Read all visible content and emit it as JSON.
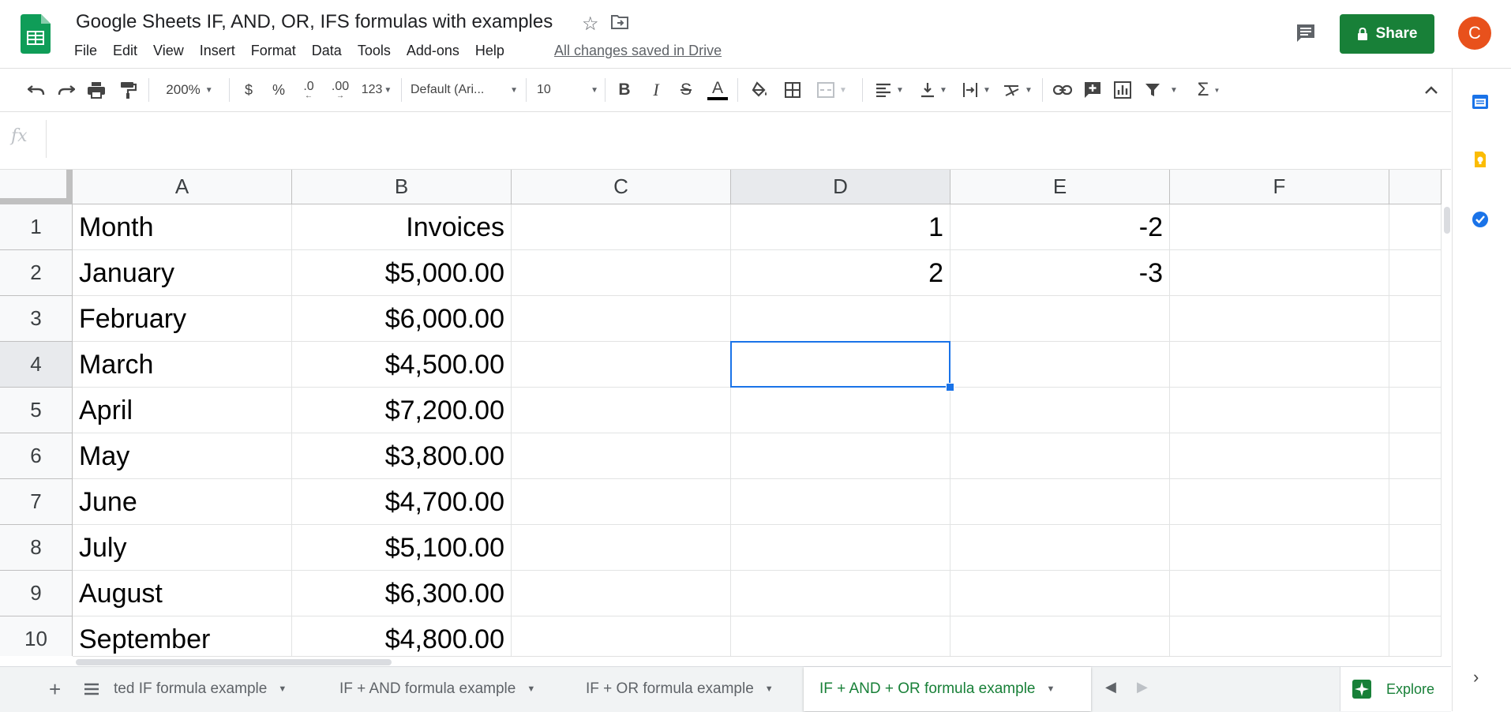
{
  "app": {
    "doc_title": "Google Sheets IF, AND, OR, IFS formulas with examples",
    "save_status": "All changes saved in Drive",
    "avatar_initial": "C",
    "share_label": "Share",
    "brand_color": "#188038"
  },
  "menu": [
    "File",
    "Edit",
    "View",
    "Insert",
    "Format",
    "Data",
    "Tools",
    "Add-ons",
    "Help"
  ],
  "toolbar": {
    "zoom": "200%",
    "currency": "$",
    "percent": "%",
    "decrease_decimal": ".0",
    "increase_decimal": ".00",
    "more_formats": "123",
    "font": "Default (Ari...",
    "font_size": "10",
    "bold": "B",
    "italic": "I",
    "strikethrough": "S",
    "text_color": "A",
    "functions": "Σ"
  },
  "formula_bar": {
    "fx": "fx",
    "value": ""
  },
  "grid": {
    "columns": [
      "A",
      "B",
      "C",
      "D",
      "E",
      "F"
    ],
    "rows": [
      {
        "num": "1",
        "A": "Month",
        "B": "Invoices",
        "C": "",
        "D": "1",
        "E": "-2",
        "F": ""
      },
      {
        "num": "2",
        "A": "January",
        "B": "$5,000.00",
        "C": "",
        "D": "2",
        "E": "-3",
        "F": ""
      },
      {
        "num": "3",
        "A": "February",
        "B": "$6,000.00",
        "C": "",
        "D": "",
        "E": "",
        "F": ""
      },
      {
        "num": "4",
        "A": "March",
        "B": "$4,500.00",
        "C": "",
        "D": "",
        "E": "",
        "F": ""
      },
      {
        "num": "5",
        "A": "April",
        "B": "$7,200.00",
        "C": "",
        "D": "",
        "E": "",
        "F": ""
      },
      {
        "num": "6",
        "A": "May",
        "B": "$3,800.00",
        "C": "",
        "D": "",
        "E": "",
        "F": ""
      },
      {
        "num": "7",
        "A": "June",
        "B": "$4,700.00",
        "C": "",
        "D": "",
        "E": "",
        "F": ""
      },
      {
        "num": "8",
        "A": "July",
        "B": "$5,100.00",
        "C": "",
        "D": "",
        "E": "",
        "F": ""
      },
      {
        "num": "9",
        "A": "August",
        "B": "$6,300.00",
        "C": "",
        "D": "",
        "E": "",
        "F": ""
      },
      {
        "num": "10",
        "A": "September",
        "B": "$4,800.00",
        "C": "",
        "D": "",
        "E": "",
        "F": ""
      }
    ],
    "selected_cell": "D4"
  },
  "sheet_tabs": [
    {
      "label": "ted IF formula example",
      "active": false
    },
    {
      "label": "IF + AND formula example",
      "active": false
    },
    {
      "label": "IF + OR formula example",
      "active": false
    },
    {
      "label": "IF + AND + OR formula example",
      "active": true
    }
  ],
  "explore_label": "Explore"
}
